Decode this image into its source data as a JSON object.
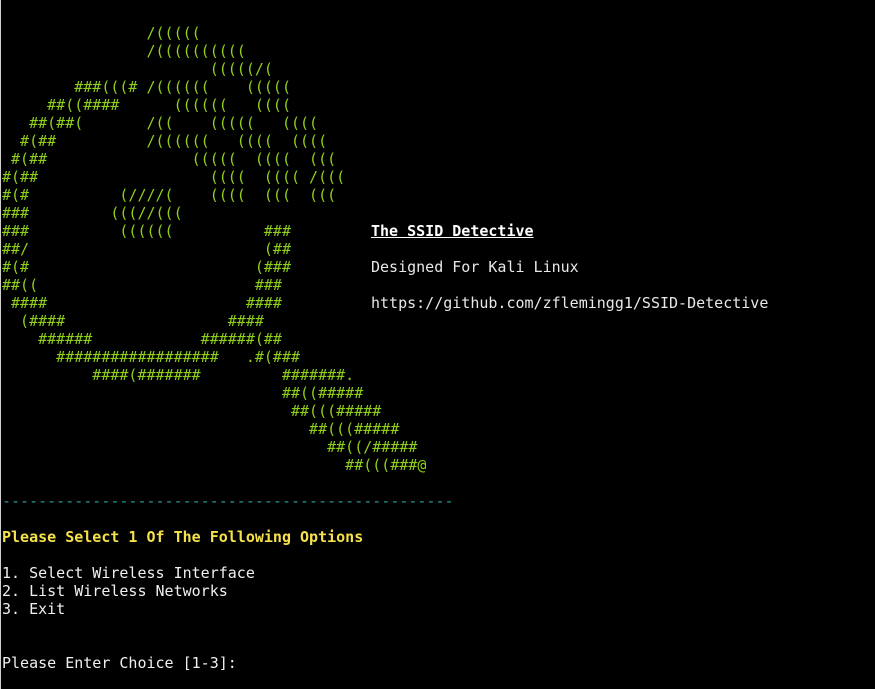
{
  "logo_art": "                /(((((\n                /((((((((((\n                       (((((/(\n        ###(((# /((((((    (((((\n     ##((####      ((((((   ((((\n   ##(##(       /((    (((((   ((((\n  #(##          /((((((   ((((  ((((\n #(##                (((((  ((((  (((\n#(##                   ((((  (((( /(((\n#(#          (////(    ((((  (((  (((\n###         (((//(((\n###          ((((((          ###\n##/                          (##\n#(#                         (###\n##((                        ###\n ####                      ####\n  (####                  ####\n    ######            ######(##\n      ##################   .#(###\n          ####(#######         #######.\n                               ##((#####\n                                ##(((#####\n                                  ##(((#####\n                                    ##((/#####\n                                      ##(((###@",
  "info": {
    "title": "The SSID Detective",
    "subtitle": "Designed For Kali Linux",
    "link": "https://github.com/zflemingg1/SSID-Detective"
  },
  "separator": "--------------------------------------------------",
  "prompt_header": "Please Select 1 Of The Following Options",
  "menu_options": [
    "1. Select Wireless Interface",
    "2. List Wireless Networks",
    "3. Exit"
  ],
  "choice_prompt": "Please Enter Choice [1-3]: ",
  "choice_value": "",
  "colors": {
    "background": "#000000",
    "art": "#8fcf1a",
    "header": "#f5e14a",
    "separator": "#2a9a8f",
    "text": "#f0f0f0"
  }
}
